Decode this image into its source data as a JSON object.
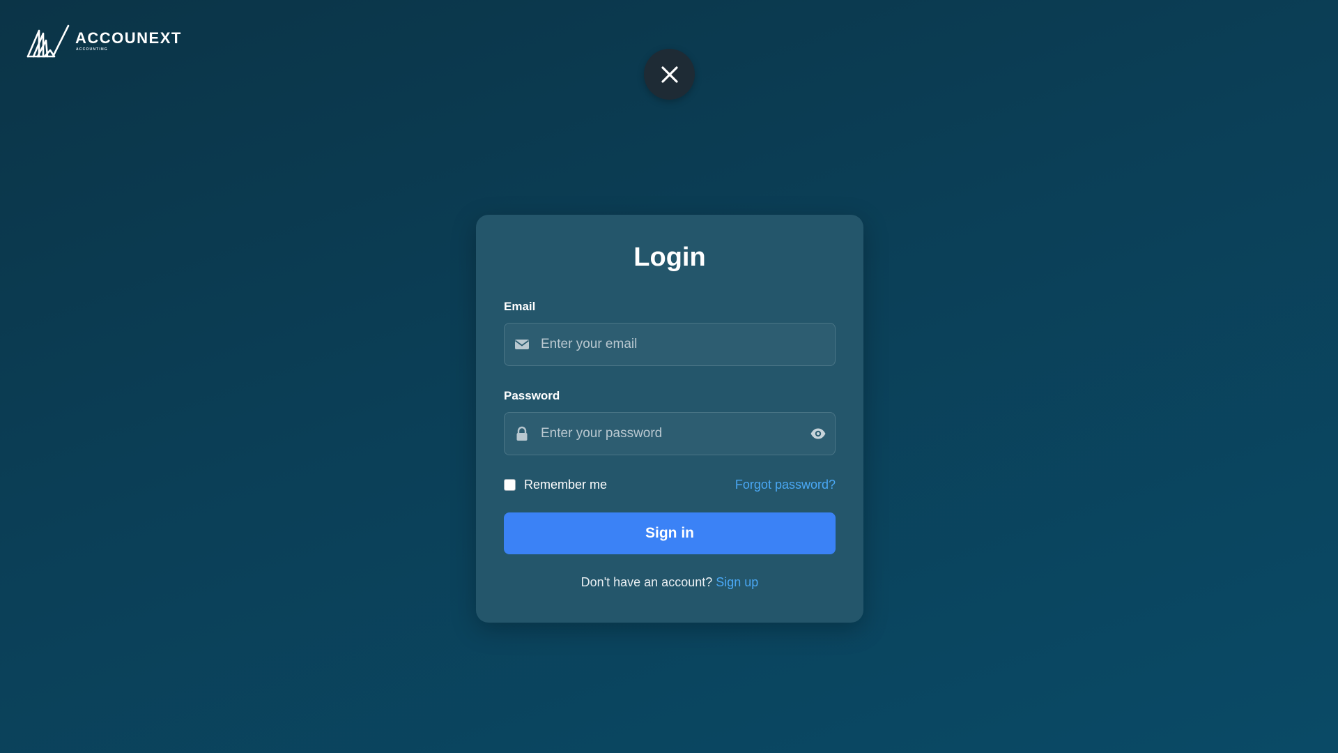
{
  "brand": {
    "name": "ACCOUNEXT",
    "subtitle": "ACCOUNTING"
  },
  "close_button": {
    "icon": "close-icon"
  },
  "login": {
    "title": "Login",
    "email_label": "Email",
    "email_placeholder": "Enter your email",
    "email_value": "",
    "email_icon": "envelope-icon",
    "password_label": "Password",
    "password_placeholder": "Enter your password",
    "password_value": "",
    "password_icon": "lock-icon",
    "password_toggle_icon": "eye-icon",
    "remember_label": "Remember me",
    "remember_checked": false,
    "forgot_label": "Forgot password?",
    "submit_label": "Sign in",
    "signup_prompt": "Don't have an account?",
    "signup_link": "Sign up"
  },
  "colors": {
    "background": "#0b3f57",
    "card": "#24566b",
    "input": "#2d5d71",
    "primary_button": "#3b82f6",
    "link": "#4aa8f5",
    "close_button": "#1e2b35"
  }
}
